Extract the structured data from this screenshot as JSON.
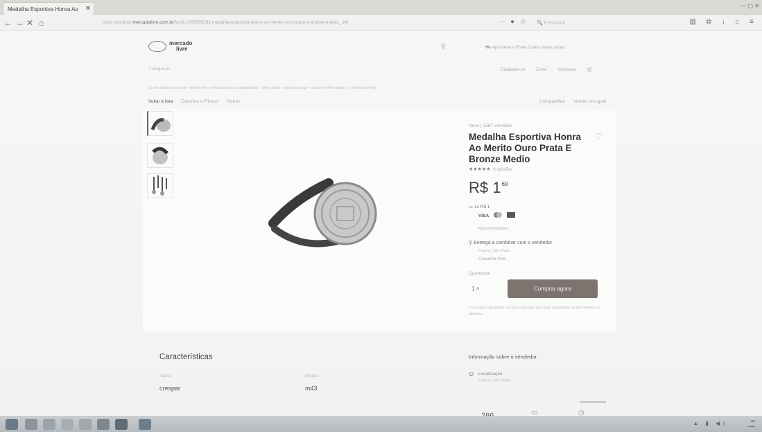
{
  "browser": {
    "tab_title": "Medalha Esportiva Honra Ao",
    "url_prefix": "https://produto.",
    "url_domain": "mercadolivre.com.br",
    "url_rest": "/MLB-1057595281-medalha-esportiva-honra-ao-merito-ouro-prata-e-bronze-medio-_JM",
    "search_placeholder": "Pesquisar"
  },
  "header": {
    "logo_line1": "mercado",
    "logo_line2": "livre",
    "promo_text": "Aproveite o Frete Grátis neste ponto",
    "categories_label": "Categorias",
    "links": [
      "Cadastre-se",
      "Entre",
      "Compras"
    ]
  },
  "ad_text": "Quero comprar um site na internet - venda anúncios cadastrados - frete grátis - mercado pago - compre online seguro - ofertas de hoje",
  "breadcrumb": {
    "back": "Voltar à lista",
    "items": [
      "Esportes e Fitness",
      "Outros"
    ]
  },
  "share_links": [
    "Compartilhar",
    "Vender um igual"
  ],
  "product": {
    "condition": "Novo  |  1567 vendidos",
    "title": "Medalha Esportiva Honra Ao Merito Ouro Prata E Bronze Medio",
    "stars": "★★★★★",
    "reviews": "6 opiniões",
    "price_main": "R$ 1",
    "price_cents": "69",
    "installments": "1x R$ 1",
    "cards_visa": "VISA",
    "more_info": "Mais informações",
    "shipping": "Entrega a combinar com o vendedor",
    "shipping_sub1": "Franca, São Paulo",
    "shipping_sub2": "Consultar frete",
    "qty_label": "Quantidade",
    "qty_value": "1",
    "buy_button": "Comprar agora",
    "guarantee": "Compra Garantida, receba o produto que está esperando ou devolvemos o dinheiro."
  },
  "characteristics": {
    "title": "Características",
    "items": [
      {
        "label": "Marca",
        "value": "crespar"
      },
      {
        "label": "Modelo",
        "value": "m43"
      }
    ]
  },
  "seller": {
    "title": "Informação sobre o vendedor",
    "location_label": "Localização",
    "location_value": "Franca, São Paulo",
    "sales_count": "286"
  },
  "colors": {
    "buy_button": "#7d7470",
    "text_dark": "#333333"
  }
}
